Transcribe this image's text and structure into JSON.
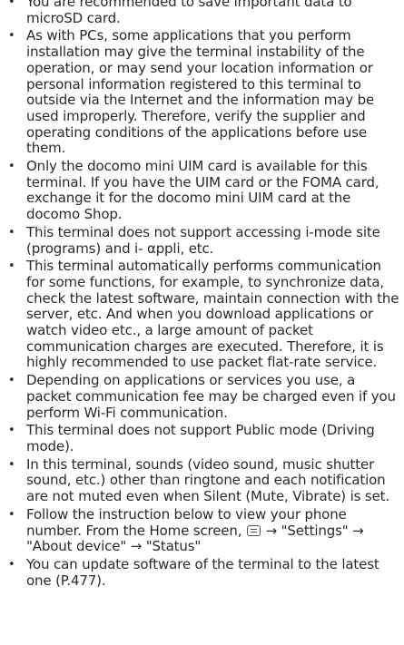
{
  "bullet_char": "•",
  "items": [
    {
      "text": "You are recommended to save important data to microSD card."
    },
    {
      "text": "As with PCs, some applications that you perform installation may give the terminal instability of the operation, or may send your location information or personal information registered to this terminal to outside via the Internet and the information may be used improperly. Therefore, verify the supplier and operating conditions of the applications before use them."
    },
    {
      "text": "Only the docomo mini UIM card is available for this terminal. If you have the UIM card or the FOMA card, exchange it for the docomo mini UIM card at the docomo Shop."
    },
    {
      "text": "This terminal does not support accessing i-mode site (programs) and i- αppli, etc."
    },
    {
      "text": "This terminal automatically performs communication for some functions, for example, to synchronize data, check the latest software, maintain connection with the server, etc. And when you download applications or watch video etc., a large amount of packet communication charges are executed. Therefore, it is highly recommended to use packet flat-rate service."
    },
    {
      "text": "Depending on applications or services you use, a packet communication fee may be charged even if you perform Wi-Fi communication."
    },
    {
      "text": "This terminal does not support Public mode (Driving mode)."
    },
    {
      "text": "In this terminal, sounds (video sound, music shutter sound, etc.) other than ringtone and each notification are not muted even when Silent (Mute, Vibrate) is set."
    },
    {
      "text_before": "Follow the instruction below to view your phone number. From the Home screen,",
      "icon": "menu-key-icon",
      "text_after": "→ \"Settings\" → \"About device\" → \"Status\""
    },
    {
      "text": "You can update software of the terminal to the latest one (P.477)."
    }
  ]
}
